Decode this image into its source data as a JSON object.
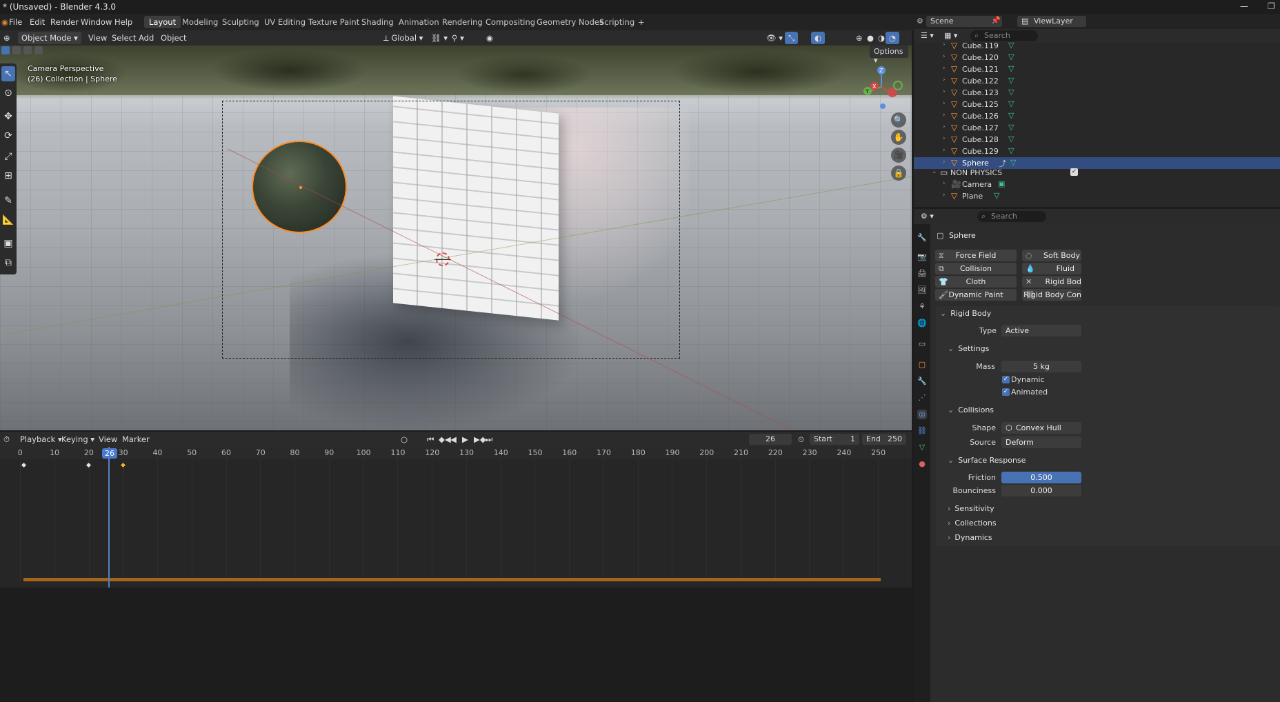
{
  "window": {
    "title": "* (Unsaved) - Blender 4.3.0"
  },
  "menu": [
    "File",
    "Edit",
    "Render",
    "Window",
    "Help"
  ],
  "workspaces": [
    "Layout",
    "Modeling",
    "Sculpting",
    "UV Editing",
    "Texture Paint",
    "Shading",
    "Animation",
    "Rendering",
    "Compositing",
    "Geometry Nodes",
    "Scripting"
  ],
  "viewport_header": {
    "mode": "Object Mode",
    "view": "View",
    "select": "Select",
    "add": "Add",
    "object": "Object",
    "orientation": "Global",
    "options": "Options"
  },
  "viewport": {
    "perspective": "Camera Perspective",
    "collection": "(26) Collection | Sphere"
  },
  "scene": {
    "label": "Scene",
    "viewlayer": "ViewLayer",
    "search_placeholder": "Search"
  },
  "outliner": {
    "rows": [
      "Cube.119",
      "Cube.120",
      "Cube.121",
      "Cube.122",
      "Cube.123",
      "Cube.125",
      "Cube.126",
      "Cube.127",
      "Cube.128",
      "Cube.129",
      "Sphere"
    ],
    "collection": "NON PHYSICS",
    "children": [
      "Camera",
      "Plane"
    ]
  },
  "timeline": {
    "menus": [
      "Playback",
      "Keying",
      "View",
      "Marker"
    ],
    "current_frame": "26",
    "start_label": "Start",
    "start": "1",
    "end_label": "End",
    "end": "250",
    "ticks": [
      "0",
      "10",
      "20",
      "30",
      "40",
      "50",
      "60",
      "70",
      "80",
      "90",
      "100",
      "110",
      "120",
      "130",
      "140",
      "150",
      "160",
      "170",
      "180",
      "190",
      "200",
      "210",
      "220",
      "230",
      "240",
      "250"
    ]
  },
  "properties": {
    "search_placeholder": "Search",
    "object": "Sphere",
    "physics_buttons": [
      "Force Field",
      "Collision",
      "Cloth",
      "Dynamic Paint",
      "Soft Body",
      "Fluid",
      "Rigid Bod",
      "Rigid Body Con"
    ],
    "rigid_body": {
      "title": "Rigid Body",
      "type_label": "Type",
      "type": "Active",
      "settings": "Settings",
      "mass_label": "Mass",
      "mass": "5 kg",
      "dynamic": "Dynamic",
      "animated": "Animated",
      "collisions": "Collisions",
      "shape_label": "Shape",
      "shape": "Convex Hull",
      "source_label": "Source",
      "source": "Deform",
      "surface_response": "Surface Response",
      "friction_label": "Friction",
      "friction": "0.500",
      "bounciness_label": "Bounciness",
      "bounciness": "0.000",
      "sensitivity": "Sensitivity",
      "collections": "Collections",
      "dynamics": "Dynamics"
    }
  },
  "colors": {
    "accent": "#4772b3",
    "selection": "#ff8a1e",
    "keyframe_selected": "#f0b232"
  }
}
